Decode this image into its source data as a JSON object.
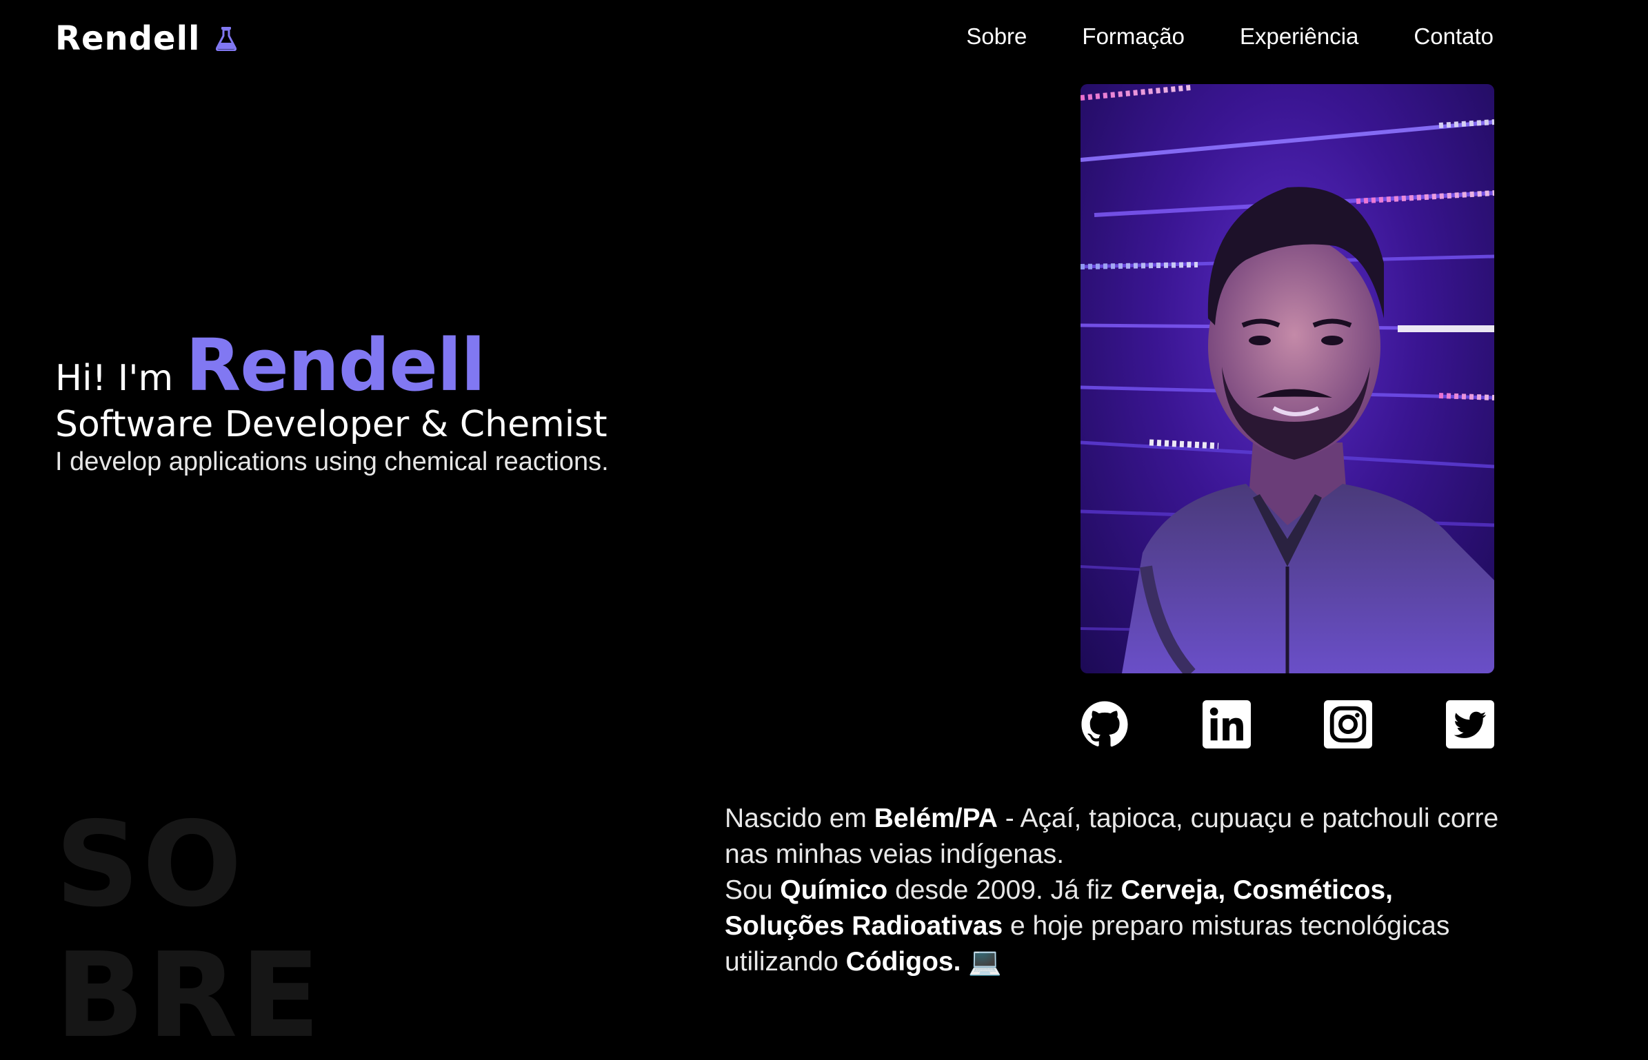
{
  "brand": {
    "name": "Rendell",
    "icon": "flask-icon",
    "accent_color": "#8178f2"
  },
  "nav": {
    "items": [
      {
        "label": "Sobre"
      },
      {
        "label": "Formação"
      },
      {
        "label": "Experiência"
      },
      {
        "label": "Contato"
      }
    ]
  },
  "hero": {
    "greeting": "Hi! I'm",
    "name": "Rendell",
    "role": "Software Developer & Chemist",
    "tagline": "I develop applications using chemical reactions."
  },
  "social": [
    {
      "icon": "github-icon"
    },
    {
      "icon": "linkedin-icon"
    },
    {
      "icon": "instagram-icon"
    },
    {
      "icon": "twitter-icon"
    }
  ],
  "about": {
    "section_word_line1": "SO",
    "section_word_line2": "BRE",
    "p1_a": "Nascido em ",
    "p1_b": "Belém/PA",
    "p1_c": " - Açaí, tapioca, cupuaçu e patchouli corre nas minhas veias indígenas.",
    "p2_a": "Sou ",
    "p2_b": "Químico",
    "p2_c": " desde 2009. Já fiz ",
    "p2_d": "Cerveja, Cosméticos, Soluções Radioativas",
    "p2_e": " e hoje preparo misturas tecnológicas utilizando ",
    "p2_f": "Códigos.",
    "laptop_emoji": "💻"
  }
}
